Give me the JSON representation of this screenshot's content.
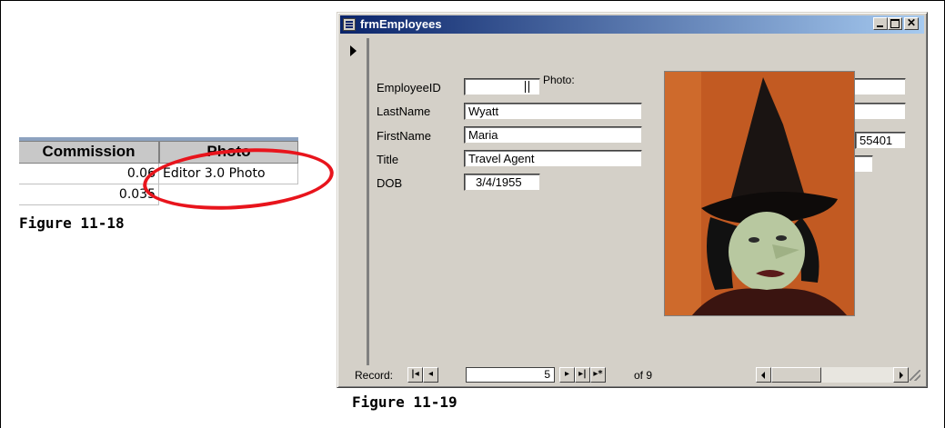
{
  "figure_18": {
    "caption": "Figure 11-18",
    "columns": [
      "Commission",
      "Photo"
    ],
    "rows": [
      {
        "commission": "0.06",
        "photo": "Editor 3.0 Photo"
      },
      {
        "commission": "0.035",
        "photo": ""
      }
    ],
    "highlight_color": "#e8141c"
  },
  "figure_19": {
    "caption": "Figure 11-19",
    "window": {
      "title": "frmEmployees"
    },
    "fields": {
      "employee_id": {
        "label": "EmployeeID",
        "value": ""
      },
      "last_name": {
        "label": "LastName",
        "value": "Wyatt"
      },
      "first_name": {
        "label": "FirstName",
        "value": "Maria"
      },
      "title": {
        "label": "Title",
        "value": "Travel Agent"
      },
      "dob": {
        "label": "DOB",
        "value": "3/4/1955"
      },
      "zip_partial": {
        "value": "55401"
      }
    },
    "photo_label": "Photo:",
    "photo_description_icon": "witch-portrait-image",
    "navigation": {
      "record_label": "Record:",
      "current_record": "5",
      "of_label": "of 9"
    }
  }
}
